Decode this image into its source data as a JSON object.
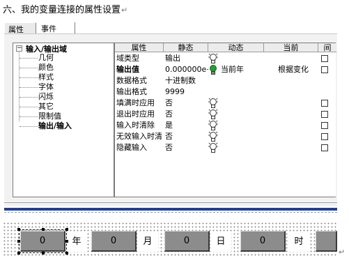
{
  "heading": "六、我的变量连接的属性设置",
  "tabs": [
    {
      "label": "属性",
      "active": true
    },
    {
      "label": "事件",
      "active": false
    }
  ],
  "tree": {
    "root": "输入/输出域",
    "items": [
      "几何",
      "颜色",
      "样式",
      "字体",
      "闪烁",
      "其它",
      "限制值",
      "输出/输入"
    ],
    "selected": "输出/输入"
  },
  "grid": {
    "headers": [
      "属性",
      "静态",
      "动态",
      "当前",
      "间"
    ],
    "rows": [
      {
        "prop": "域类型",
        "static": "输出",
        "bulb": "off",
        "dynamic": "",
        "current": "",
        "checkbox": true,
        "bold": false
      },
      {
        "prop": "输出值",
        "static": "0.000000e+",
        "bulb": "on",
        "dynamic": "当前年",
        "current": "根据变化",
        "checkbox": true,
        "bold": true
      },
      {
        "prop": "数据格式",
        "static": "十进制数",
        "bulb": "none",
        "dynamic": "",
        "current": "",
        "checkbox": false,
        "bold": false
      },
      {
        "prop": "输出格式",
        "static": "9999",
        "bulb": "none",
        "dynamic": "",
        "current": "",
        "checkbox": false,
        "bold": false
      },
      {
        "prop": "填满时应用",
        "static": "否",
        "bulb": "off",
        "dynamic": "",
        "current": "",
        "checkbox": true,
        "bold": false
      },
      {
        "prop": "退出时应用",
        "static": "否",
        "bulb": "off",
        "dynamic": "",
        "current": "",
        "checkbox": true,
        "bold": false
      },
      {
        "prop": "输入时清除",
        "static": "是",
        "bulb": "off",
        "dynamic": "",
        "current": "",
        "checkbox": true,
        "bold": false
      },
      {
        "prop": "无效输入时清",
        "static": "否",
        "bulb": "off",
        "dynamic": "",
        "current": "",
        "checkbox": true,
        "bold": false
      },
      {
        "prop": "隐藏输入",
        "static": "否",
        "bulb": "off",
        "dynamic": "",
        "current": "",
        "checkbox": true,
        "bold": false
      }
    ]
  },
  "display": {
    "fields": [
      {
        "value": "0",
        "unit": "年"
      },
      {
        "value": "0",
        "unit": "月"
      },
      {
        "value": "0",
        "unit": "日"
      },
      {
        "value": "0",
        "unit": "时"
      }
    ]
  },
  "colors": {
    "accent_bar": "#1f3f9c",
    "io_field": "#8c8c8c",
    "bulb_on": "#22a032"
  },
  "icons": {
    "bulb_off": "lightbulb-outline-icon",
    "bulb_on": "lightbulb-green-icon"
  }
}
